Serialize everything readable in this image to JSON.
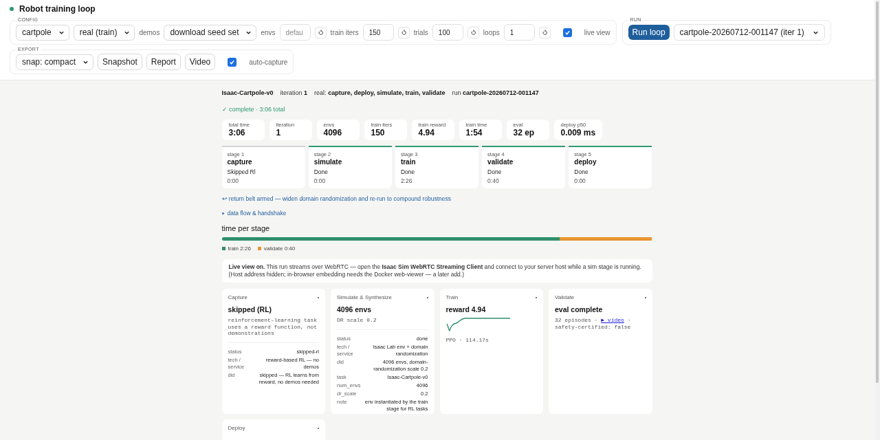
{
  "app": {
    "title": "Robot training loop"
  },
  "config": {
    "legend": "CONFIG",
    "controls": [
      {
        "kind": "select",
        "value": "cartpole"
      },
      {
        "kind": "select",
        "value": "real (train)"
      },
      {
        "kind": "label",
        "text": "demos"
      },
      {
        "kind": "select",
        "value": "download seed set"
      },
      {
        "kind": "label",
        "text": "envs"
      },
      {
        "kind": "input",
        "placeholder": "defau"
      },
      {
        "kind": "reset"
      },
      {
        "kind": "label",
        "text": "train iters"
      },
      {
        "kind": "input",
        "value": "150"
      },
      {
        "kind": "reset"
      },
      {
        "kind": "label",
        "text": "trials"
      },
      {
        "kind": "input",
        "value": "100"
      },
      {
        "kind": "reset"
      },
      {
        "kind": "label",
        "text": "loops"
      },
      {
        "kind": "input",
        "value": "1"
      },
      {
        "kind": "reset"
      },
      {
        "kind": "checkbox",
        "checked": true
      },
      {
        "kind": "label",
        "text": "live view"
      }
    ]
  },
  "run": {
    "legend": "RUN",
    "button": "Run loop",
    "select": "cartpole-20260712-001147 (iter 1)"
  },
  "export": {
    "legend": "EXPORT",
    "controls": [
      {
        "kind": "select",
        "value": "snap: compact"
      },
      {
        "kind": "button",
        "text": "Snapshot"
      },
      {
        "kind": "button",
        "text": "Report"
      },
      {
        "kind": "button",
        "text": "Video"
      },
      {
        "kind": "checkbox",
        "checked": true
      },
      {
        "kind": "label",
        "text": "auto-capture"
      }
    ]
  },
  "summary": [
    {
      "value": "Isaac-Cartpole-v0"
    },
    {
      "label": "iteration",
      "value": "1"
    },
    {
      "label": "real:",
      "value": "capture, deploy, simulate, train, validate"
    },
    {
      "label": "run",
      "value": "cartpole-20260712-001147"
    }
  ],
  "status_line": "✓ complete · 3:06 total",
  "metrics": [
    {
      "label": "total time",
      "value": "3:06"
    },
    {
      "label": "iteration",
      "value": "1"
    },
    {
      "label": "envs",
      "value": "4096"
    },
    {
      "label": "train iters",
      "value": "150"
    },
    {
      "label": "train reward",
      "value": "4.94"
    },
    {
      "label": "train time",
      "value": "1:54"
    },
    {
      "label": "eval",
      "value": "32 ep"
    },
    {
      "label": "deploy p50",
      "value": "0.009 ms"
    }
  ],
  "stages": [
    {
      "number": "stage 1",
      "name": "capture",
      "status": "Skipped Rl",
      "time": "0:00",
      "color": "#d4d4d4"
    },
    {
      "number": "stage 2",
      "name": "simulate",
      "status": "Done",
      "time": "0:00",
      "color": "#2f9a6e"
    },
    {
      "number": "stage 3",
      "name": "train",
      "status": "Done",
      "time": "2:26",
      "color": "#2f9a6e"
    },
    {
      "number": "stage 4",
      "name": "validate",
      "status": "Done",
      "time": "0:40",
      "color": "#2f9a6e"
    },
    {
      "number": "stage 5",
      "name": "deploy",
      "status": "Done",
      "time": "0:00",
      "color": "#2f9a6e"
    }
  ],
  "return_note": "↩ return belt armed — widen domain randomization and re-run to compound robustness",
  "disclosure": {
    "text": "data flow & handshake",
    "expanded": false
  },
  "time_chart": {
    "title": "time per stage",
    "segments": [
      {
        "label": "train 2:26",
        "level": 0.785,
        "color": "#2f8f6b"
      },
      {
        "label": "validate 0:40",
        "level": 0.215,
        "color": "#e8962f"
      }
    ]
  },
  "live_note": "**Live view on.** This run streams over WebRTC — open the **Isaac Sim WebRTC Streaming Client** and connect to your server host while a sim stage is running. (Host address hidden; in-browser embedding needs the Docker web-viewer — a later add.)",
  "cards": [
    {
      "kind": "details",
      "title": "Capture",
      "headline": "skipped (RL)",
      "note": "reinforcement-learning task uses a reward function, not demonstrations",
      "rows": [
        {
          "key": "status",
          "value": "skipped-rl"
        },
        {
          "key": "tech / service",
          "value": "reward-based RL — no demos"
        },
        {
          "key": "did",
          "value": "skipped — RL learns from reward, no demos needed"
        }
      ]
    },
    {
      "kind": "details",
      "title": "Simulate & Synthesize",
      "headline": "4096 envs",
      "note": "DR scale 0.2",
      "rows": [
        {
          "key": "status",
          "value": "done"
        },
        {
          "key": "tech / service",
          "value": "Isaac Lab env + domain randomization"
        },
        {
          "key": "did",
          "value": "4096 envs, domain-randomization scale 0.2"
        },
        {
          "key": "task",
          "value": "Isaac-Cartpole-v0"
        },
        {
          "key": "num_envs",
          "value": "4096"
        },
        {
          "key": "dr_scale",
          "value": "0.2"
        },
        {
          "key": "note",
          "value": "env instantiated by the train stage for RL tasks"
        }
      ]
    },
    {
      "kind": "curve",
      "title": "Train",
      "headline": "reward 4.94",
      "note": "PPO · 114.17s"
    },
    {
      "kind": "video",
      "title": "Validate",
      "headline": "eval complete",
      "note": "32 episodes · ",
      "link": "▶ video",
      "note_after": " · safety-certified: false"
    },
    {
      "kind": "title",
      "title": "Deploy"
    }
  ]
}
